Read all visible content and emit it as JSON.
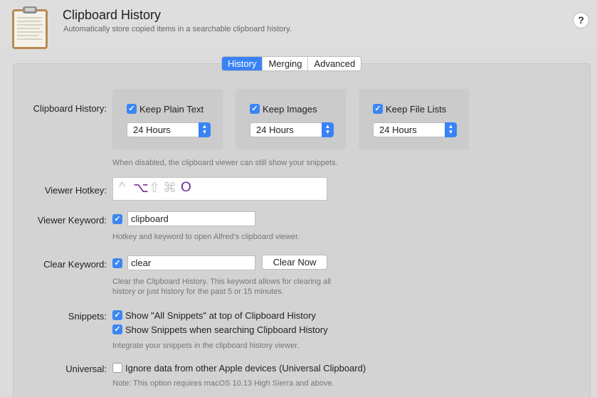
{
  "header": {
    "title": "Clipboard History",
    "subtitle": "Automatically store copied items in a searchable clipboard history.",
    "help": "?"
  },
  "tabs": [
    {
      "label": "History",
      "active": true
    },
    {
      "label": "Merging",
      "active": false
    },
    {
      "label": "Advanced",
      "active": false
    }
  ],
  "clipboard_history": {
    "label": "Clipboard History:",
    "options": [
      {
        "label": "Keep Plain Text",
        "checked": true,
        "duration": "24 Hours"
      },
      {
        "label": "Keep Images",
        "checked": true,
        "duration": "24 Hours"
      },
      {
        "label": "Keep File Lists",
        "checked": true,
        "duration": "24 Hours"
      }
    ],
    "hint": "When disabled, the clipboard viewer can still show your snippets."
  },
  "viewer_hotkey": {
    "label": "Viewer Hotkey:",
    "modifiers": [
      "^",
      "⌥",
      "⇧",
      "⌘"
    ],
    "key": "O"
  },
  "viewer_keyword": {
    "label": "Viewer Keyword:",
    "checked": true,
    "value": "clipboard",
    "hint": "Hotkey and keyword to open Alfred's clipboard viewer."
  },
  "clear_keyword": {
    "label": "Clear Keyword:",
    "checked": true,
    "value": "clear",
    "button": "Clear Now",
    "hint_line1": "Clear the Clipboard History. This keyword allows for clearing all",
    "hint_line2": "history or just history for the past 5 or 15 minutes."
  },
  "snippets": {
    "label": "Snippets:",
    "option1": "Show \"All Snippets\" at top of Clipboard History",
    "option2": "Show Snippets when searching Clipboard History",
    "hint": "Integrate your snippets in the clipboard history viewer."
  },
  "universal": {
    "label": "Universal:",
    "option": "Ignore data from other Apple devices (Universal Clipboard)",
    "checked": false,
    "hint": "Note: This option requires macOS 10.13 High Sierra and above."
  },
  "colors": {
    "accent": "#3a83f6",
    "hotkey_active": "#6a2a8f"
  }
}
